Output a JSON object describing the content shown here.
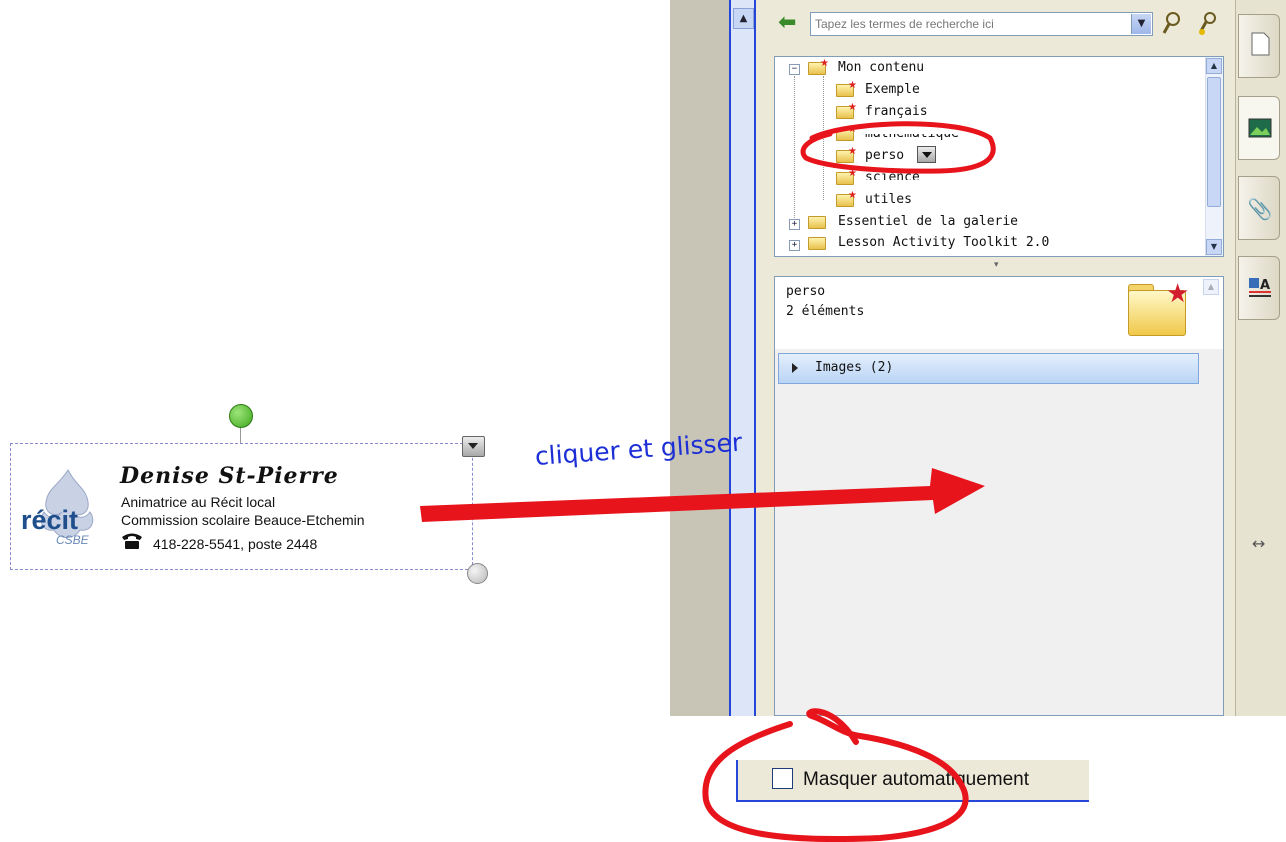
{
  "signature": {
    "name": "Denise St-Pierre",
    "line1": "Animatrice au Récit local",
    "line2": "Commission scolaire Beauce-Etchemin",
    "phone": "418-228-5541, poste 2448",
    "logo_text": "récit",
    "logo_sub": "CSBE",
    "phone_icon": "phone-icon"
  },
  "annotation": {
    "text": "cliquer et glisser",
    "color": "#1c2fd6",
    "arrow_color": "#e8141c"
  },
  "gallery": {
    "search_placeholder": "Tapez les termes de recherche ici",
    "icons": [
      "back-arrow-icon",
      "search-icon",
      "advanced-search-icon"
    ],
    "tree": {
      "root": "Mon contenu",
      "children": [
        "Exemple",
        "français",
        "mathématique",
        "perso",
        "science",
        "utiles"
      ],
      "others": [
        "Essentiel de la galerie",
        "Lesson Activity Toolkit 2.0"
      ]
    },
    "selected": {
      "name": "perso",
      "count": "2 éléments"
    },
    "sections": [
      {
        "label": "Images (2)"
      }
    ]
  },
  "side_tabs": [
    "page-sorter-icon",
    "gallery-icon",
    "attachments-icon",
    "properties-icon"
  ],
  "autohide": {
    "label": "Masquer automatiquement",
    "checked": false
  },
  "highlight_color": "#e8141c"
}
